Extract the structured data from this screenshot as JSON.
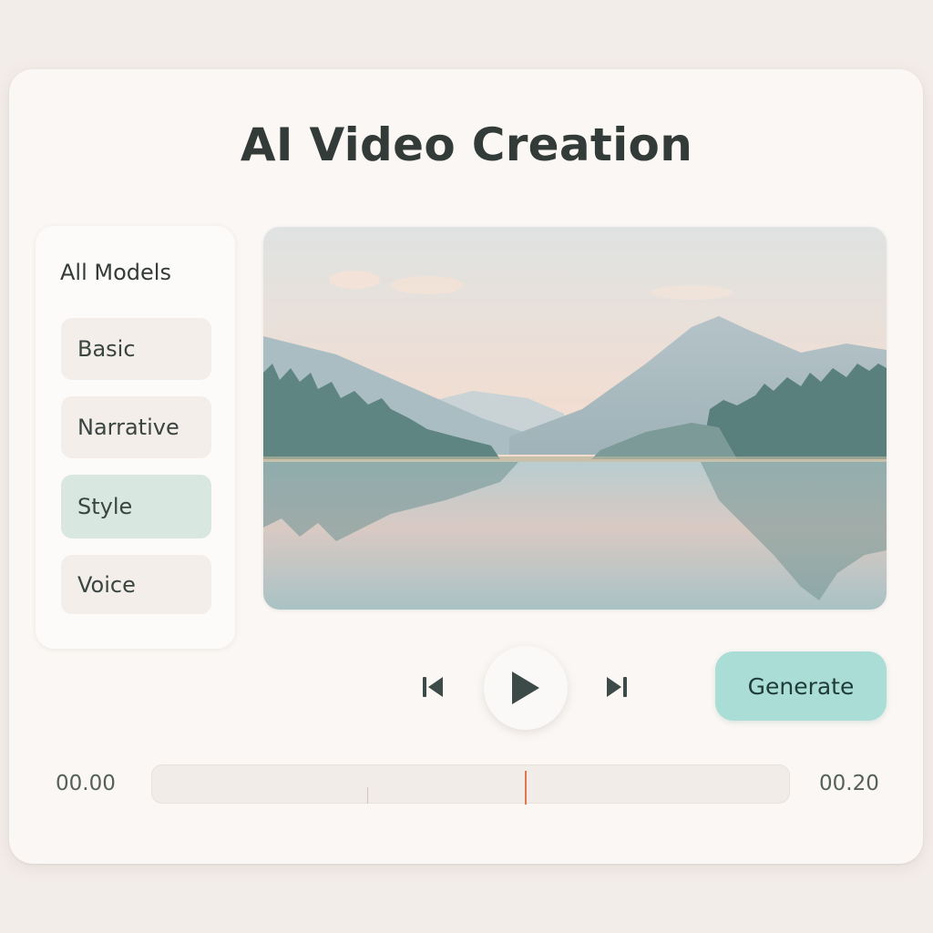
{
  "title": "AI Video Creation",
  "sidebar": {
    "heading": "All Models",
    "items": [
      {
        "label": "Basic",
        "active": false
      },
      {
        "label": "Narrative",
        "active": false
      },
      {
        "label": "Style",
        "active": true
      },
      {
        "label": "Voice",
        "active": false
      }
    ]
  },
  "preview": {
    "scene": "mountain lake landscape at dusk",
    "icon": "video-preview"
  },
  "controls": {
    "prev_icon": "skip-previous-icon",
    "play_icon": "play-icon",
    "next_icon": "skip-next-icon",
    "generate_label": "Generate"
  },
  "timeline": {
    "start_time": "00.00",
    "end_time": "00.20"
  },
  "colors": {
    "accent": "#a9ddd6",
    "active_item": "#d8e8e1",
    "playhead": "#e0774f",
    "text": "#323b38"
  }
}
